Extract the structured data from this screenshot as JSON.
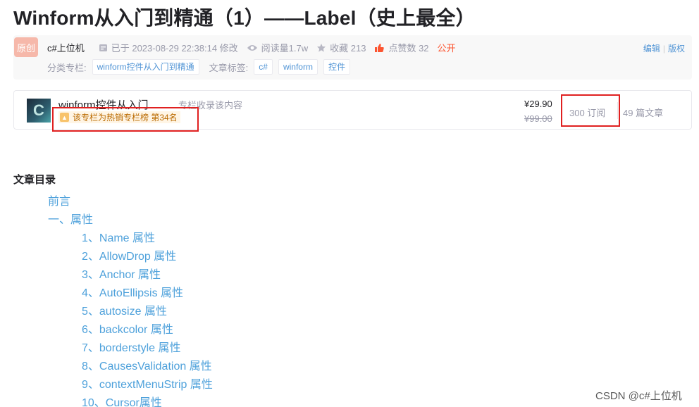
{
  "article": {
    "title": "Winform从入门到精通（1）——Label（史上最全）"
  },
  "meta": {
    "badge": "原创",
    "author": "c#上位机",
    "modified": "已于 2023-08-29 22:38:14 修改",
    "reads": "阅读量1.7w",
    "favorites": "收藏 213",
    "likes": "点赞数 32",
    "visibility": "公开",
    "edit": "编辑",
    "copyright": "版权",
    "category_label": "分类专栏:",
    "category": "winform控件从入门到精通",
    "tags_label": "文章标签:",
    "tags": [
      "c#",
      "winform",
      "控件"
    ]
  },
  "column": {
    "logo": "C",
    "name": "winform控件从入门...",
    "desc": "专栏收录该内容",
    "hot": "该专栏为热销专栏榜 第34名",
    "price": "¥29.90",
    "old_price": "¥99.00",
    "subscriptions": "300 订阅",
    "articles": "49 篇文章"
  },
  "toc": {
    "title": "文章目录",
    "items": [
      {
        "text": "前言",
        "level": 1
      },
      {
        "text": "一、属性",
        "level": 1
      },
      {
        "text": "1、Name 属性",
        "level": 2
      },
      {
        "text": "2、AllowDrop 属性",
        "level": 2
      },
      {
        "text": "3、Anchor 属性",
        "level": 2
      },
      {
        "text": "4、AutoEllipsis 属性",
        "level": 2
      },
      {
        "text": "5、autosize 属性",
        "level": 2
      },
      {
        "text": "6、backcolor 属性",
        "level": 2
      },
      {
        "text": "7、borderstyle 属性",
        "level": 2
      },
      {
        "text": "8、CausesValidation 属性",
        "level": 2
      },
      {
        "text": "9、contextMenuStrip 属性",
        "level": 2
      },
      {
        "text": "10、Cursor属性",
        "level": 2
      }
    ]
  },
  "watermark": "CSDN @c#上位机",
  "colors": {
    "link": "#4ea1db",
    "accent": "#fc5531",
    "highlight_box": "#e02020"
  }
}
